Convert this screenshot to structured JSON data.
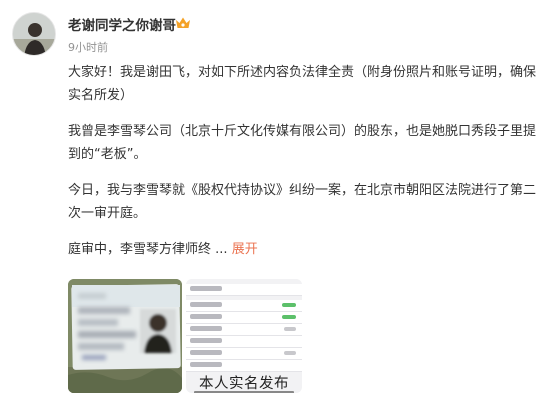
{
  "user": {
    "name": "老谢同学之你谢哥",
    "badge_icon": "vip-crown-icon",
    "timestamp": "9小时前"
  },
  "post": {
    "paragraphs": [
      "大家好！我是谢田飞，对如下所述内容负法律全责（附身份照片和账号证明，确保实名所发）",
      "我曾是李雪琴公司（北京十斤文化传媒有限公司）的股东，也是她脱口秀段子里提到的“老板”。",
      "今日，我与李雪琴就《股权代持协议》纠纷一案，在北京市朝阳区法院进行了第二次一审开庭。"
    ],
    "truncated_text": "庭审中，李雪琴方律师终",
    "ellipsis": "...",
    "expand_label": "展开",
    "accent_color": "#eb7350"
  },
  "images": [
    {
      "name": "id-card-photo",
      "description_icon": "id-card-icon"
    },
    {
      "name": "account-verification-screenshot",
      "caption": "本人实名发布"
    }
  ]
}
